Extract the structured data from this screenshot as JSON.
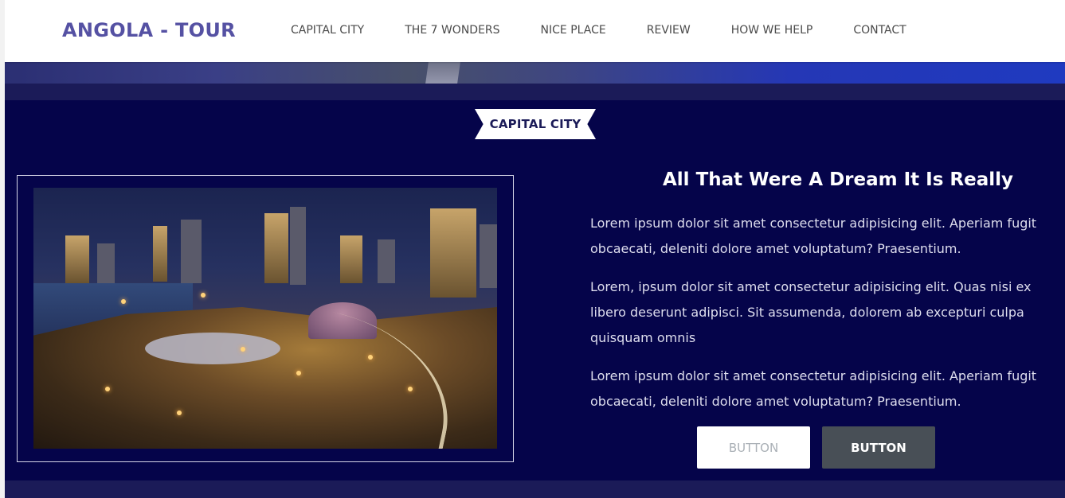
{
  "navbar": {
    "brand": "ANGOLA - TOUR",
    "links": [
      "CAPITAL CITY",
      "THE 7 WONDERS",
      "NICE PLACE",
      "REVIEW",
      "HOW WE HELP",
      "CONTACT"
    ]
  },
  "section": {
    "ribbon_label": "CAPITAL CITY",
    "heading": "All That Were A Dream It Is Really",
    "paragraphs": [
      "Lorem ipsum dolor sit amet consectetur adipisicing elit. Aperiam fugit obcaecati, deleniti dolore amet voluptatum? Praesentium.",
      "Lorem, ipsum dolor sit amet consectetur adipisicing elit. Quas nisi ex libero deserunt adipisci. Sit assumenda, dolorem ab excepturi culpa quisquam omnis",
      "Lorem ipsum dolor sit amet consectetur adipisicing elit. Aperiam fugit obcaecati, deleniti dolore amet voluptatum? Praesentium."
    ],
    "buttons": [
      "BUTTON",
      "BUTTON"
    ]
  },
  "colors": {
    "brand": "#5551a3",
    "section_bg": "#05044a",
    "band_bg": "#1b1b58",
    "dark_button": "#484f56"
  }
}
